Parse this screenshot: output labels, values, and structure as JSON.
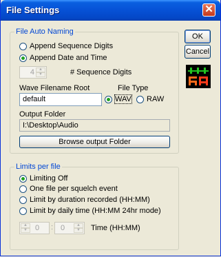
{
  "window": {
    "title": "File Settings"
  },
  "buttons": {
    "ok": "OK",
    "cancel": "Cancel",
    "browse": "Browse output Folder"
  },
  "auto_naming": {
    "legend": "File Auto Naming",
    "opt_sequence": "Append Sequence Digits",
    "opt_date": "Append Date and Time",
    "selected": "date",
    "seq_digits_value": "4",
    "seq_digits_label": "# Sequence Digits",
    "wave_root_label": "Wave Filename Root",
    "wave_root_value": "default",
    "file_type_label": "File Type",
    "type_wav": "WAV",
    "type_raw": "RAW",
    "file_type_selected": "WAV",
    "output_folder_label": "Output Folder",
    "output_folder_value": "I:\\Desktop\\Audio"
  },
  "limits": {
    "legend": "Limits per file",
    "opt_off": "Limiting Off",
    "opt_squelch": "One file per squelch event",
    "opt_duration": "Limit by duration recorded (HH:MM)",
    "opt_daily": "Limit by daily time (HH:MM 24hr mode)",
    "selected": "off",
    "hours": "0",
    "minutes": "0",
    "time_label": "Time (HH:MM)"
  }
}
